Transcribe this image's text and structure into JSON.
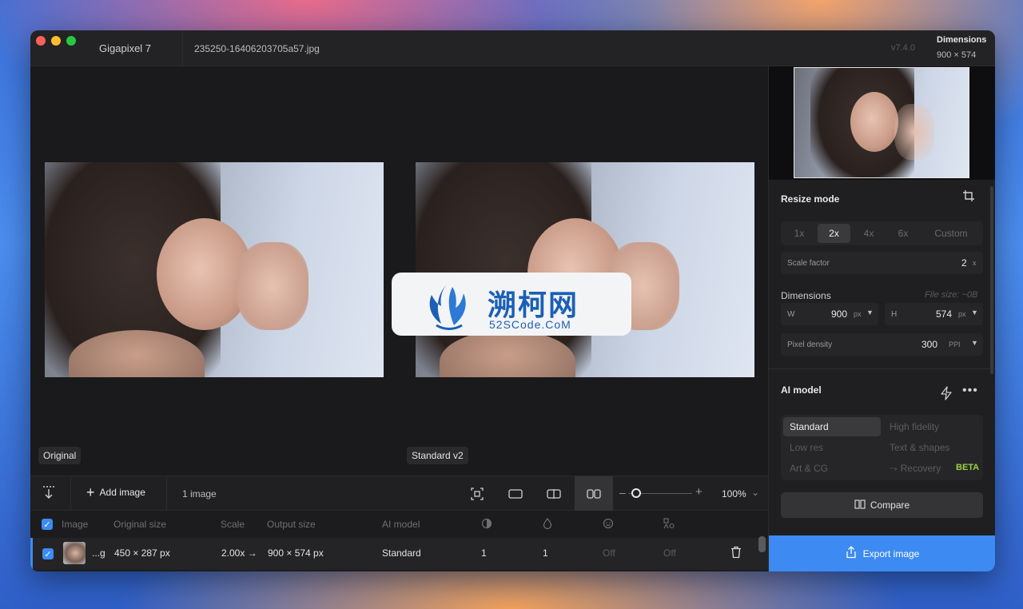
{
  "titlebar": {
    "app_title": "Gigapixel 7",
    "file_name": "235250-16406203705a57.jpg",
    "version": "v7.4.0",
    "dimensions_title": "Dimensions",
    "dimensions_value": "900 × 574"
  },
  "canvas": {
    "left_label": "Original",
    "right_label": "Standard v2"
  },
  "watermark": {
    "cn_text": "溯柯网",
    "en_text": "52SCode.CoM"
  },
  "toolbar": {
    "add_image_label": "Add image",
    "image_count": "1 image",
    "zoom_value": "100%",
    "zoom_level": 1.0
  },
  "table": {
    "headers": {
      "image": "Image",
      "original_size": "Original size",
      "scale": "Scale",
      "output_size": "Output size",
      "ai_model": "AI model"
    },
    "row": {
      "name": "...g",
      "original_size": "450 × 287 px",
      "scale": "2.00x →",
      "output_size": "900 × 574 px",
      "ai_model": "Standard",
      "col1": "1",
      "col2": "1",
      "col3": "Off",
      "col4": "Off"
    }
  },
  "sidebar": {
    "resize_mode_title": "Resize mode",
    "scale_options": [
      "1x",
      "2x",
      "4x",
      "6x",
      "Custom"
    ],
    "selected_scale": "2x",
    "scale_factor_label": "Scale factor",
    "scale_factor_value": "2",
    "scale_factor_unit": "x",
    "dimensions_label": "Dimensions",
    "file_size": "File size: ~0B",
    "width_label": "W",
    "width_value": "900",
    "width_unit": "px",
    "height_label": "H",
    "height_value": "574",
    "height_unit": "px",
    "pixel_density_label": "Pixel density",
    "pixel_density_value": "300",
    "pixel_density_unit": "PPI",
    "ai_model_title": "AI model",
    "models": [
      "Standard",
      "High fidelity",
      "Low res",
      "Text & shapes",
      "Art & CG",
      "Recovery"
    ],
    "selected_model": "Standard",
    "beta_badge": "BETA",
    "compare_label": "Compare",
    "export_label": "Export image"
  },
  "colors": {
    "accent": "#3d8bf2",
    "beta": "#9bd243",
    "window_bg": "#1c1c1e"
  }
}
